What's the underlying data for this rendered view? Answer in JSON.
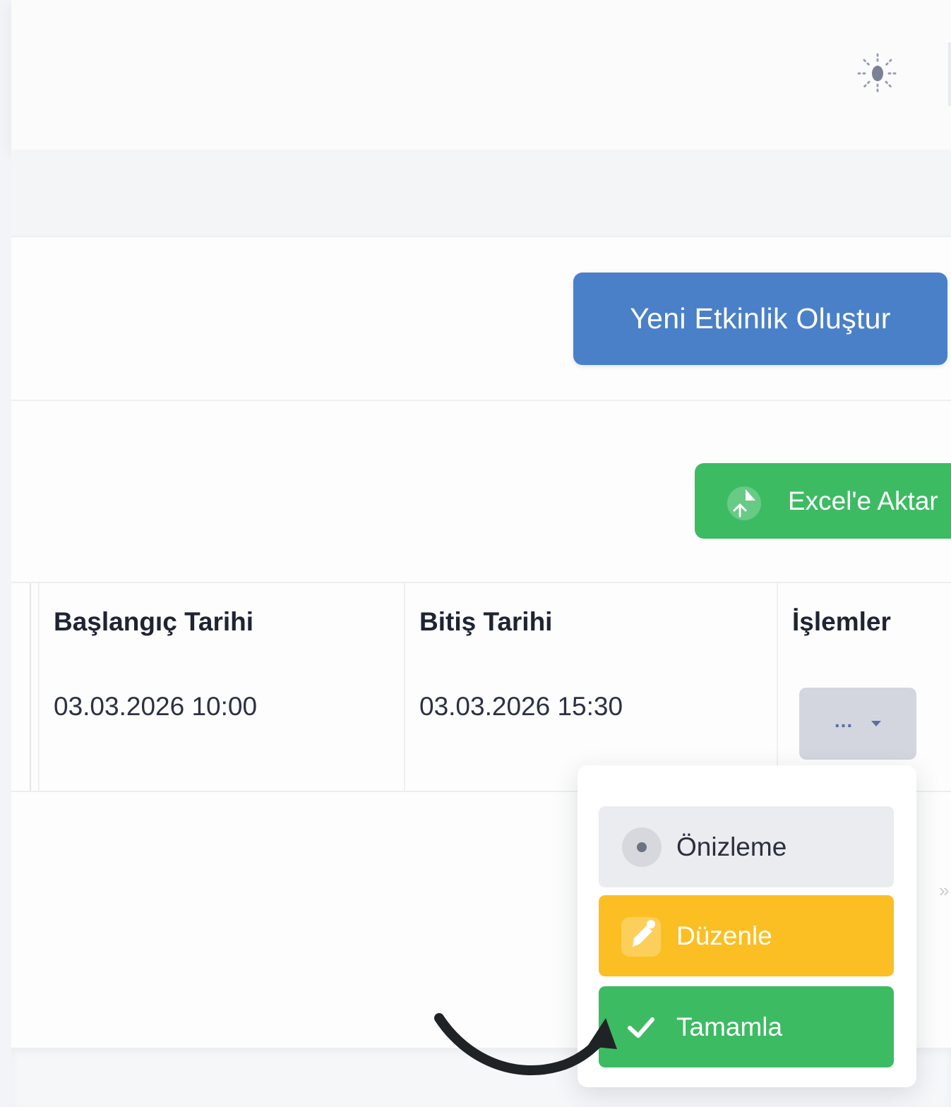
{
  "header": {
    "theme_toggle_icon": "sun-icon"
  },
  "create_button": {
    "label": "Yeni Etkinlik Oluştur",
    "color": "#4a80c8"
  },
  "export_button": {
    "label": "Excel'e Aktar",
    "icon": "excel-export-icon",
    "color": "#3dbb63"
  },
  "table": {
    "columns": [
      "Başlangıç Tarihi",
      "Bitiş Tarihi",
      "İşlemler"
    ],
    "rows": [
      {
        "start": "03.03.2026 10:00",
        "end": "03.03.2026 15:30",
        "actions_label": "..."
      }
    ]
  },
  "actions_menu": {
    "items": [
      {
        "label": "Önizleme",
        "icon": "eye-icon",
        "color": "#ebecf0"
      },
      {
        "label": "Düzenle",
        "icon": "edit-icon",
        "color": "#fbbf24"
      },
      {
        "label": "Tamamla",
        "icon": "check-icon",
        "color": "#3dbb63"
      }
    ]
  },
  "annotation": {
    "arrow_target": "Tamamla"
  }
}
